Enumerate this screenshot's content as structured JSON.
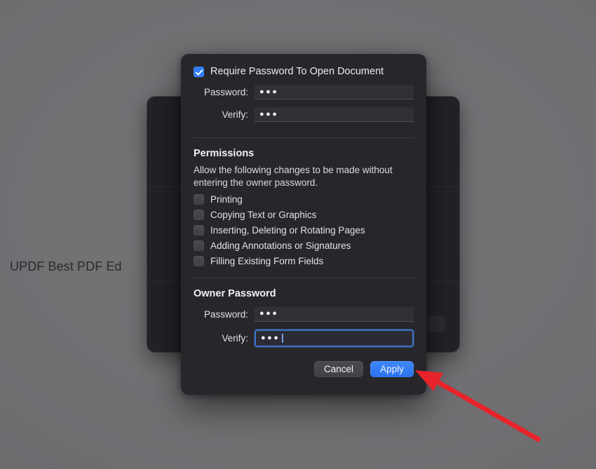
{
  "background": {
    "window_label": "UPDF Best PDF Ed"
  },
  "dialog": {
    "require_password": {
      "label": "Require Password To Open Document",
      "checked": true
    },
    "open_password": {
      "password_label": "Password:",
      "password_value": "●●●",
      "verify_label": "Verify:",
      "verify_value": "●●●"
    },
    "permissions": {
      "title": "Permissions",
      "description": "Allow the following changes to be made without entering the owner password.",
      "items": [
        {
          "label": "Printing",
          "checked": false
        },
        {
          "label": "Copying Text or Graphics",
          "checked": false
        },
        {
          "label": "Inserting, Deleting or Rotating Pages",
          "checked": false
        },
        {
          "label": "Adding Annotations or Signatures",
          "checked": false
        },
        {
          "label": "Filling Existing Form Fields",
          "checked": false
        }
      ]
    },
    "owner_password": {
      "title": "Owner Password",
      "password_label": "Password:",
      "password_value": "●●●",
      "verify_label": "Verify:",
      "verify_value": "●●●",
      "verify_focused": true
    },
    "buttons": {
      "cancel": "Cancel",
      "apply": "Apply"
    }
  },
  "annotation": {
    "arrow_color": "#E8232A",
    "points_to": "apply-button"
  },
  "colors": {
    "accent_blue": "#2F7CF6",
    "dialog_background": "#26262B",
    "desktop_background": "#6E6E70",
    "focus_ring": "#3D73C4"
  }
}
